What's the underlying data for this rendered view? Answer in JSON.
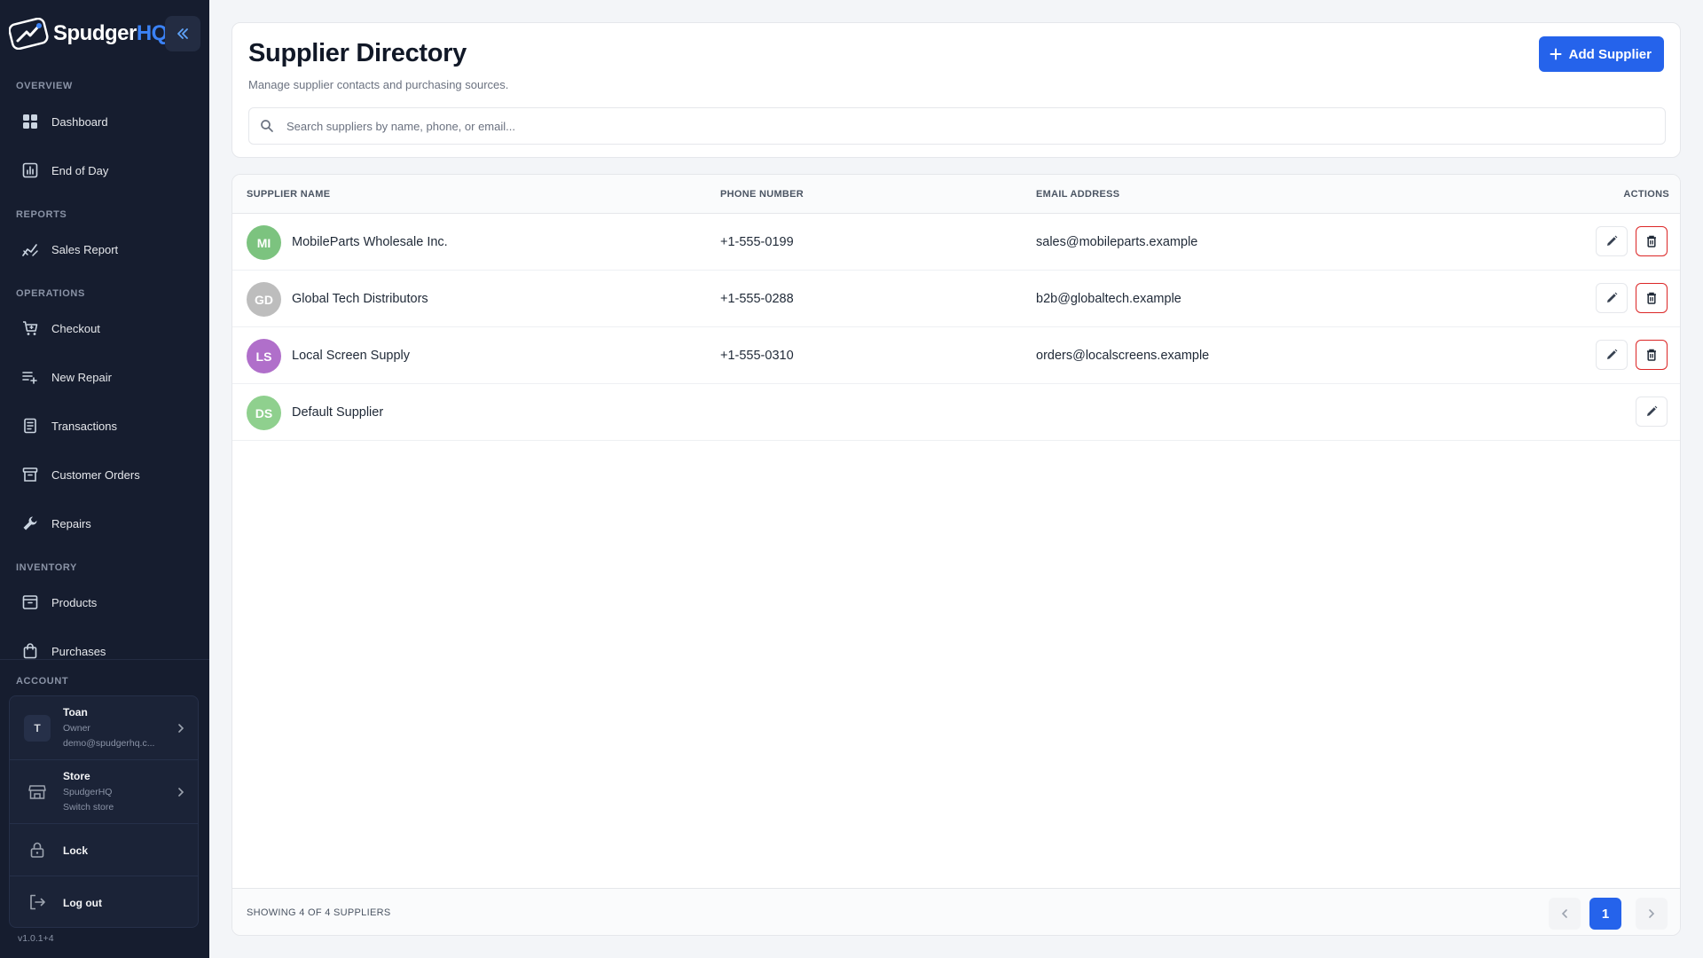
{
  "brand": {
    "name_main": "Spudger",
    "name_accent": "HQ"
  },
  "sidebar": {
    "sections": {
      "overview": "OVERVIEW",
      "reports": "REPORTS",
      "operations": "OPERATIONS",
      "inventory": "INVENTORY",
      "account": "ACCOUNT"
    },
    "items": {
      "dashboard": "Dashboard",
      "end_of_day": "End of Day",
      "sales_report": "Sales Report",
      "checkout": "Checkout",
      "new_repair": "New Repair",
      "transactions": "Transactions",
      "customer_orders": "Customer Orders",
      "repairs": "Repairs",
      "products": "Products",
      "purchases": "Purchases"
    },
    "account": {
      "user": {
        "initial": "T",
        "name": "Toan",
        "role": "Owner",
        "email": "demo@spudgerhq.c..."
      },
      "store": {
        "title": "Store",
        "name": "SpudgerHQ",
        "action": "Switch store"
      },
      "lock": "Lock",
      "logout": "Log out"
    },
    "version": "v1.0.1+4"
  },
  "header": {
    "title": "Supplier Directory",
    "subtitle": "Manage supplier contacts and purchasing sources.",
    "add_button": "Add Supplier",
    "search_placeholder": "Search suppliers by name, phone, or email..."
  },
  "table": {
    "columns": {
      "name": "SUPPLIER NAME",
      "phone": "PHONE NUMBER",
      "email": "EMAIL ADDRESS",
      "actions": "ACTIONS"
    },
    "rows": [
      {
        "initials": "MI",
        "name": "MobileParts Wholesale Inc.",
        "phone": "+1-555-0199",
        "email": "sales@mobileparts.example",
        "avatar_color": "#7cc37f"
      },
      {
        "initials": "GD",
        "name": "Global Tech Distributors",
        "phone": "+1-555-0288",
        "email": "b2b@globaltech.example",
        "avatar_color": "#bdbdbd"
      },
      {
        "initials": "LS",
        "name": "Local Screen Supply",
        "phone": "+1-555-0310",
        "email": "orders@localscreens.example",
        "avatar_color": "#b06fca"
      },
      {
        "initials": "DS",
        "name": "Default Supplier",
        "phone": "",
        "email": "",
        "avatar_color": "#8fd08e"
      }
    ],
    "footer": {
      "showing": "SHOWING 4 OF 4 SUPPLIERS",
      "current_page": "1"
    }
  },
  "colors": {
    "sidebar_bg": "#161d2f",
    "accent": "#2563eb",
    "danger": "#dc2626",
    "brand_accent": "#3b82f6"
  }
}
